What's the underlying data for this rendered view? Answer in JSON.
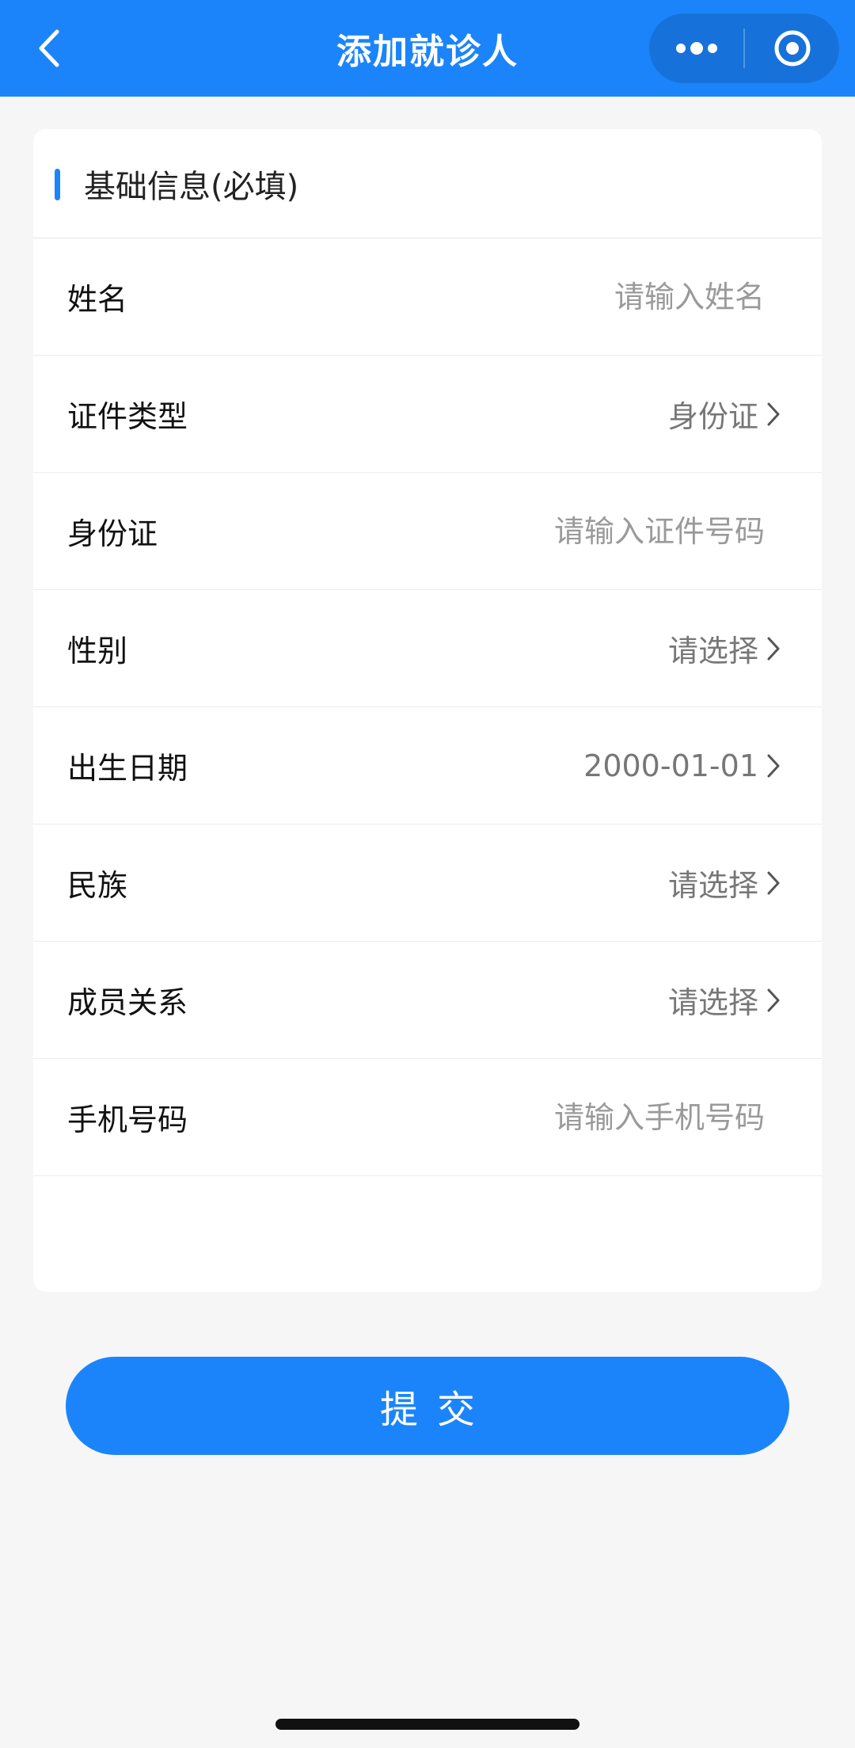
{
  "header": {
    "title": "添加就诊人",
    "back_icon": "chevron-left-icon",
    "more_icon": "more-dots-icon",
    "close_icon": "target-circle-icon",
    "bg_color": "#1b84fb"
  },
  "section": {
    "title": "基础信息(必填)"
  },
  "rows": [
    {
      "label": "姓名",
      "placeholder": "请输入姓名",
      "type": "input"
    },
    {
      "label": "证件类型",
      "value": "身份证",
      "type": "select"
    },
    {
      "label": "身份证",
      "placeholder": "请输入证件号码",
      "type": "input"
    },
    {
      "label": "性别",
      "value": "请选择",
      "type": "select"
    },
    {
      "label": "出生日期",
      "value": "2000-01-01",
      "type": "select"
    },
    {
      "label": "民族",
      "value": "请选择",
      "type": "select"
    },
    {
      "label": "成员关系",
      "value": "请选择",
      "type": "select"
    },
    {
      "label": "手机号码",
      "placeholder": "请输入手机号码",
      "type": "input"
    }
  ],
  "submit": {
    "label": "提交"
  }
}
